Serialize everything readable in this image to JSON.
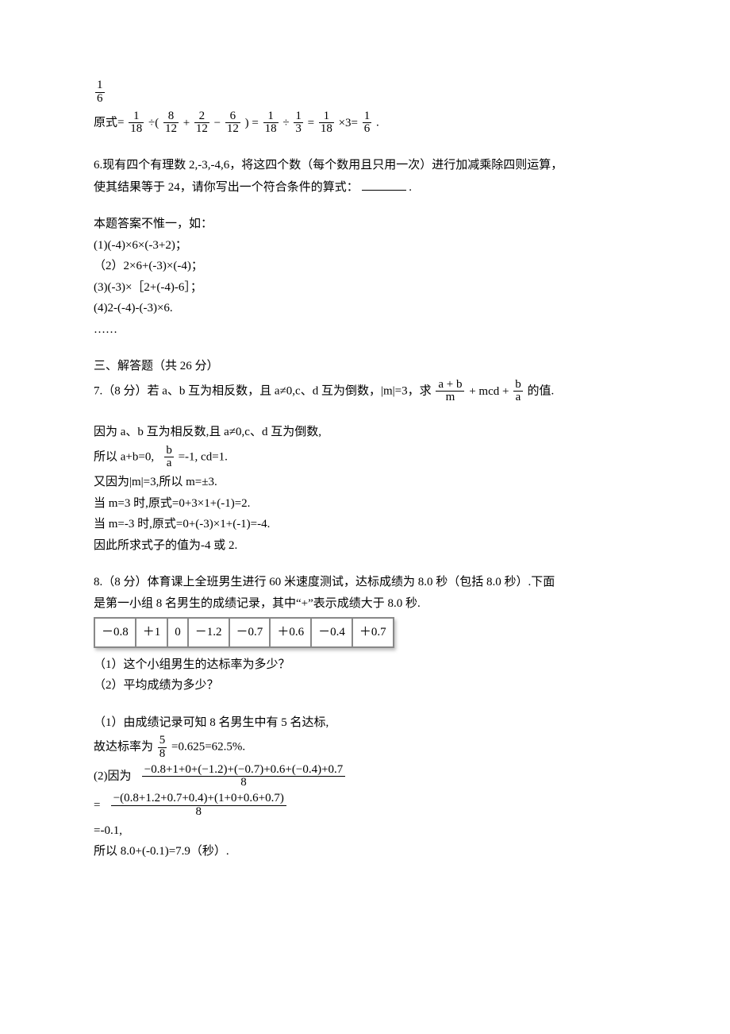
{
  "top_frac": {
    "num": "1",
    "den": "6"
  },
  "eq5": {
    "prefix": "原式=",
    "a": {
      "num": "1",
      "den": "18"
    },
    "op1": "÷(",
    "b": {
      "num": "8",
      "den": "12"
    },
    "op2": "+",
    "c": {
      "num": "2",
      "den": "12"
    },
    "op3": "−",
    "d": {
      "num": "6",
      "den": "12"
    },
    "op4": ") =",
    "e": {
      "num": "1",
      "den": "18"
    },
    "op5": "÷",
    "f": {
      "num": "1",
      "den": "3"
    },
    "op6": "=",
    "g": {
      "num": "1",
      "den": "18"
    },
    "op7": "×3=",
    "h": {
      "num": "1",
      "den": "6"
    },
    "end": "."
  },
  "q6": {
    "text1": "6.现有四个有理数 2,-3,-4,6，将这四个数（每个数用且只用一次）进行加减乘除四则运算，",
    "text2": "使其结果等于 24，请你写出一个符合条件的算式：",
    "period": ".",
    "answers_intro": "本题答案不惟一，如：",
    "a1": "(1)(-4)×6×(-3+2)；",
    "a2": "（2）2×6+(-3)×(-4)；",
    "a3": "(3)(-3)×［2+(-4)-6］；",
    "a4": "(4)2-(-4)-(-3)×6.",
    "dots": "……"
  },
  "sec3": "三、解答题（共 26 分）",
  "q7": {
    "line1a": "7.（8 分）若 a、b 互为相反数，且 a≠0,c、d 互为倒数，|m|=3，求",
    "f1": {
      "num": "a + b",
      "den": "m"
    },
    "plus1": "+ mcd +",
    "f2": {
      "num": "b",
      "den": "a"
    },
    "line1b": " 的值.",
    "s1": "因为 a、b 互为相反数,且 a≠0,c、d 互为倒数,",
    "s2a": "所以 a+b=0,",
    "s2f": {
      "num": "b",
      "den": "a"
    },
    "s2b": "=-1, cd=1.",
    "s3": "又因为|m|=3,所以 m=±3.",
    "s4": "当 m=3 时,原式=0+3×1+(-1)=2.",
    "s5": "当 m=-3 时,原式=0+(-3)×1+(-1)=-4.",
    "s6": "因此所求式子的值为-4 或 2."
  },
  "q8": {
    "line1": "8.（8 分）体育课上全班男生进行 60 米速度测试，达标成绩为 8.0 秒（包括 8.0 秒）.下面",
    "line2": "是第一小组 8 名男生的成绩记录，其中“+”表示成绩大于 8.0 秒.",
    "table": [
      "－0.8",
      "＋1",
      "0",
      "－1.2",
      "－0.7",
      "＋0.6",
      "－0.4",
      "＋0.7"
    ],
    "sub1": "（1）这个小组男生的达标率为多少？",
    "sub2": "（2）平均成绩为多少？",
    "a1": "（1）由成绩记录可知 8 名男生中有 5 名达标,",
    "a1b_pre": "故达标率为",
    "a1b_frac": {
      "num": "5",
      "den": "8"
    },
    "a1b_post": "=0.625=62.5%.",
    "a2_pre": "(2)因为",
    "a2_f1": {
      "num": "−0.8+1+0+(−1.2)+(−0.7)+0.6+(−0.4)+0.7",
      "den": "8"
    },
    "a2_eq": "=",
    "a2_f2": {
      "num": "−(0.8+1.2+0.7+0.4)+(1+0+0.6+0.7)",
      "den": "8"
    },
    "a2_res": "=-0.1,",
    "a2_final": "所以 8.0+(-0.1)=7.9（秒）."
  }
}
